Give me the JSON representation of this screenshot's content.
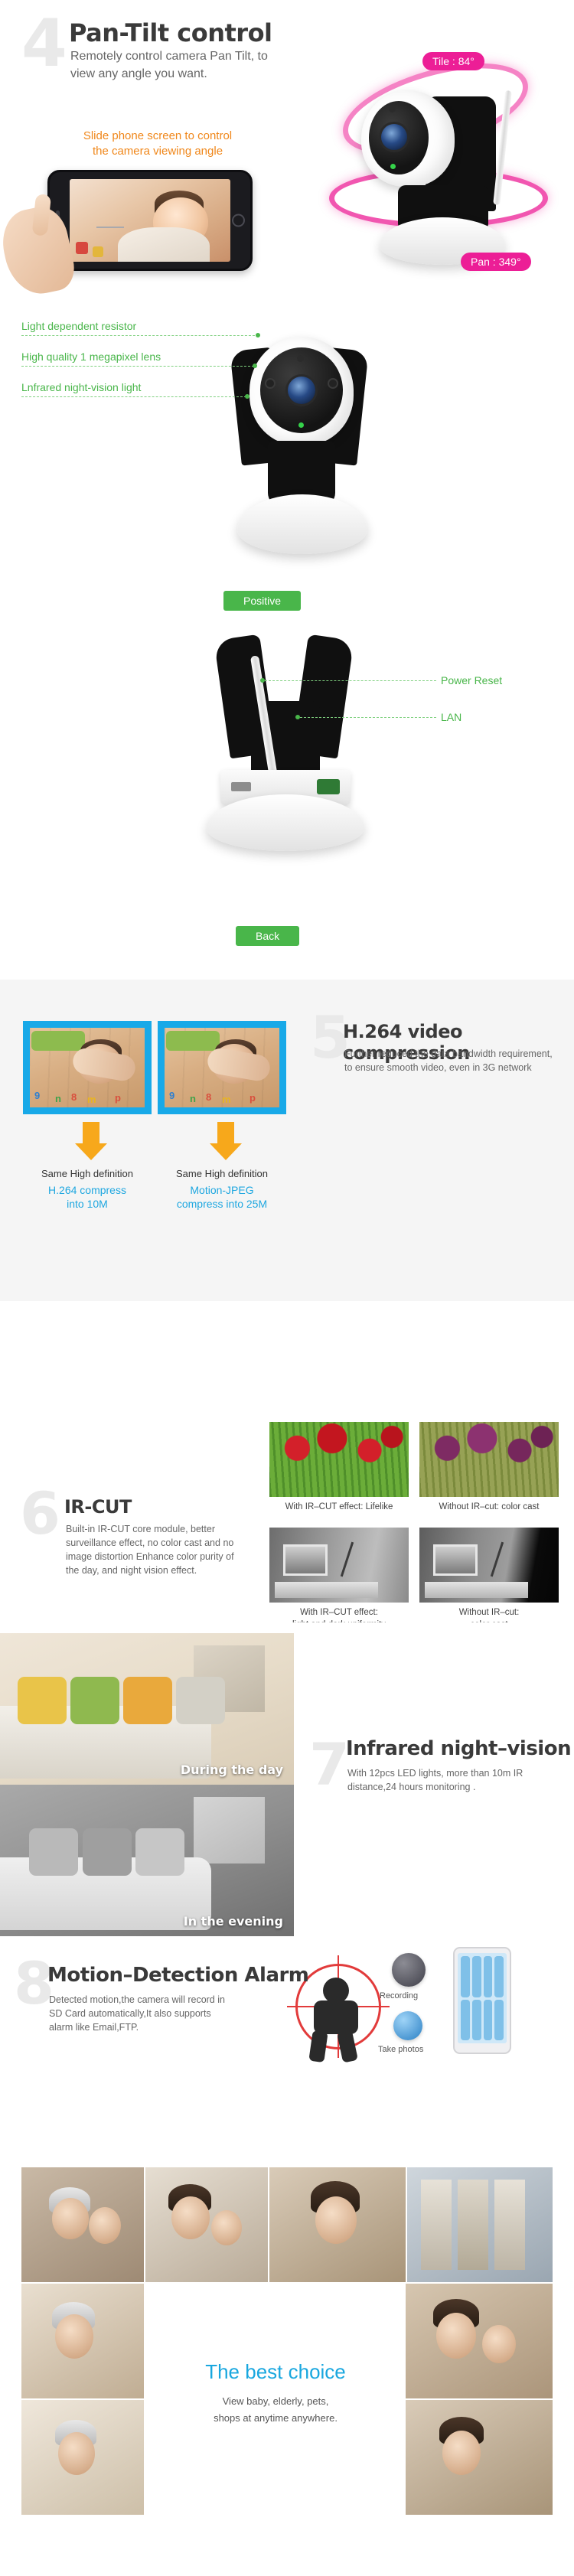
{
  "section_pantilt": {
    "number": "4",
    "title": "Pan-Tilt control",
    "description": "Remotely control camera Pan Tilt, to view any angle you want.",
    "slide_caption": "Slide phone screen to control\nthe camera viewing angle",
    "tilt_badge": "Tile : 84°",
    "pan_badge": "Pan : 349°",
    "accent_pink": "#ec1e96",
    "accent_orange": "#f0871a"
  },
  "section_diagram": {
    "front_labels": [
      "Light dependent resistor",
      "High quality 1 megapixel lens",
      "Lnfrared night-vision light"
    ],
    "front_badge": "Positive",
    "back_labels": [
      "Power Reset",
      "LAN"
    ],
    "back_badge": "Back",
    "accent_green": "#49b64a"
  },
  "section_h264": {
    "number": "5",
    "title": "H.264 video compression",
    "description": "Further reduced the data bandwidth requirement, to ensure smooth video, even in 3G network",
    "left_caption_top": "Same High definition",
    "left_caption_bottom": "H.264 compress\ninto 10M",
    "right_caption_top": "Same High definition",
    "right_caption_bottom": "Motion-JPEG\ncompress into 25M",
    "frame_border_color": "#18a9e8",
    "arrow_color": "#f7a81b",
    "blue_text_color": "#1ea7e0",
    "background": "#f5f5f5"
  },
  "section_ircut": {
    "number": "6",
    "title": "IR-CUT",
    "description": "Built-in IR-CUT core module, better surveillance effect, no color cast and no image distortion Enhance color purity of the day, and night vision effect.",
    "captions": [
      "With IR–CUT effect: Lifelike",
      "Without IR–cut: color cast",
      "With IR–CUT effect:\nlight and dark uniformity",
      "Without IR–cut:\ncolor cast"
    ]
  },
  "section_night": {
    "number": "7",
    "title": "Infrared night–vision",
    "description": "With 12pcs LED lights, more than 10m IR distance,24 hours monitoring .",
    "image_caption_day": "During the day",
    "image_caption_evening": "In the evening"
  },
  "section_motion": {
    "number": "8",
    "title": "Motion–Detection Alarm",
    "description": "Detected motion,the camera will record in SD Card automatically,It also supports alarm like Email,FTP.",
    "icon_recording_label": "Recording",
    "icon_photo_label": "Take photos",
    "crosshair_color": "#e23b3b"
  },
  "section_collage": {
    "title": "The best choice",
    "line1": "View baby, elderly, pets,",
    "line2": "shops at anytime anywhere.",
    "title_color": "#19a7df"
  }
}
